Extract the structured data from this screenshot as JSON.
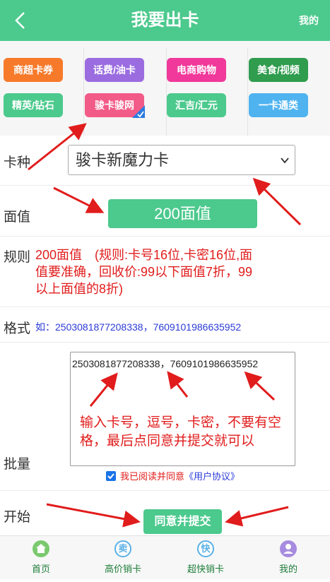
{
  "header": {
    "title": "我要出卡",
    "mine": "我的"
  },
  "categories": [
    {
      "label": "商超卡券",
      "color": "#f77a2b"
    },
    {
      "label": "话费/油卡",
      "color": "#9a6ce0"
    },
    {
      "label": "电商购物",
      "color": "#f0399a"
    },
    {
      "label": "美食/视频",
      "color": "#2f9c4e"
    },
    {
      "label": "精英/钻石",
      "color": "#4cc98d"
    },
    {
      "label": "骏卡骏网",
      "color": "#f25a87"
    },
    {
      "label": "汇吉/汇元",
      "color": "#4cc98d"
    },
    {
      "label": "一卡通类",
      "color": "#4fb3f0"
    }
  ],
  "form": {
    "card_type_label": "卡种",
    "card_type_value": "骏卡新魔力卡",
    "face_label": "面值",
    "face_value": "200面值",
    "rule_label": "规则",
    "rule_text": "200面值　(规则:卡号16位,卡密16位,面值要准确，回收价:99以下面值7折，99以上面值的8折)",
    "format_label": "格式",
    "format_text": "如：2503081877208338，7609101986635952",
    "batch_label": "批量",
    "batch_value": "2503081877208338，7609101986635952",
    "hint_text": "输入卡号，逗号，卡密，不要有空格，最后点同意并提交就可以",
    "agree_text": "我已阅读并同意",
    "protocol_text": "《用户协议》",
    "start_label": "开始",
    "submit_label": "同意并提交"
  },
  "tabbar": [
    {
      "label": "首页",
      "icon": "home-icon",
      "color": "#1e7d3a",
      "icon_color": "#7bc96f"
    },
    {
      "label": "高价销卡",
      "icon": "sell-icon",
      "color": "#1e7d3a",
      "icon_color": "#5ab0e6"
    },
    {
      "label": "超快销卡",
      "icon": "fast-icon",
      "color": "#1e7d3a",
      "icon_color": "#5ab0e6"
    },
    {
      "label": "我的",
      "icon": "user-icon",
      "color": "#1e7d3a",
      "icon_color": "#a78be0"
    }
  ],
  "tab_glyphs": {
    "sell": "卖",
    "fast": "快"
  }
}
